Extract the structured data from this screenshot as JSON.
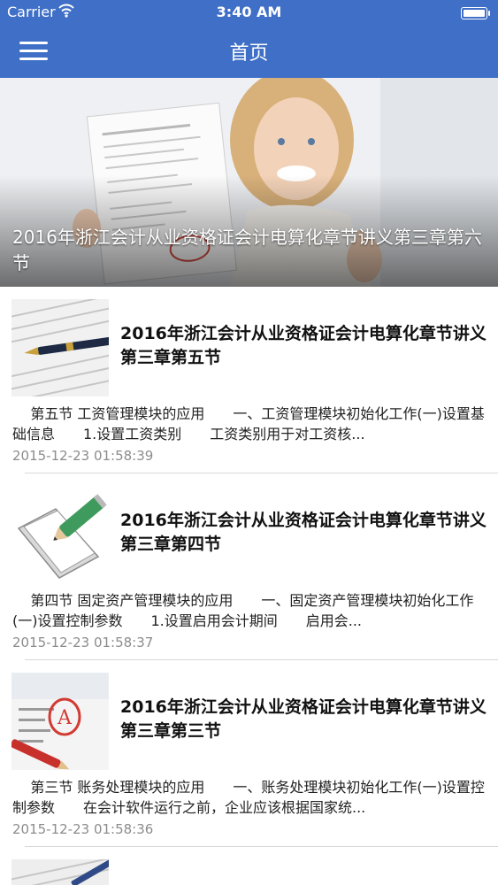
{
  "status_bar": {
    "carrier": "Carrier",
    "time": "3:40 AM"
  },
  "nav": {
    "title": "首页",
    "menu_icon": "hamburger-menu-icon"
  },
  "banner": {
    "title": "2016年浙江会计从业资格证会计电算化章节讲义第三章第六节"
  },
  "articles": [
    {
      "title": "2016年浙江会计从业资格证会计电算化章节讲义第三章第五节",
      "summary": "    第五节 工资管理模块的应用　　一、工资管理模块初始化工作(一)设置基础信息　　1.设置工资类别　　工资类别用于对工资核...",
      "date": "2015-12-23 01:58:39"
    },
    {
      "title": "2016年浙江会计从业资格证会计电算化章节讲义第三章第四节",
      "summary": "    第四节 固定资产管理模块的应用　　一、固定资产管理模块初始化工作　　(一)设置控制参数　　1.设置启用会计期间　　启用会...",
      "date": "2015-12-23 01:58:37"
    },
    {
      "title": "2016年浙江会计从业资格证会计电算化章节讲义第三章第三节",
      "summary": "    第三节 账务处理模块的应用　　一、账务处理模块初始化工作(一)设置控制参数　　在会计软件运行之前，企业应该根据国家统...",
      "date": "2015-12-23 01:58:36"
    }
  ]
}
